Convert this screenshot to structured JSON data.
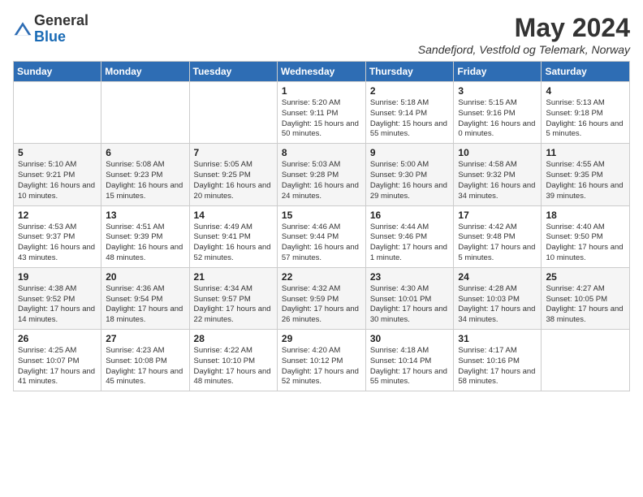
{
  "logo": {
    "general": "General",
    "blue": "Blue"
  },
  "header": {
    "month_year": "May 2024",
    "location": "Sandefjord, Vestfold og Telemark, Norway"
  },
  "days_of_week": [
    "Sunday",
    "Monday",
    "Tuesday",
    "Wednesday",
    "Thursday",
    "Friday",
    "Saturday"
  ],
  "weeks": [
    [
      {
        "day": "",
        "info": ""
      },
      {
        "day": "",
        "info": ""
      },
      {
        "day": "",
        "info": ""
      },
      {
        "day": "1",
        "info": "Sunrise: 5:20 AM\nSunset: 9:11 PM\nDaylight: 15 hours and 50 minutes."
      },
      {
        "day": "2",
        "info": "Sunrise: 5:18 AM\nSunset: 9:14 PM\nDaylight: 15 hours and 55 minutes."
      },
      {
        "day": "3",
        "info": "Sunrise: 5:15 AM\nSunset: 9:16 PM\nDaylight: 16 hours and 0 minutes."
      },
      {
        "day": "4",
        "info": "Sunrise: 5:13 AM\nSunset: 9:18 PM\nDaylight: 16 hours and 5 minutes."
      }
    ],
    [
      {
        "day": "5",
        "info": "Sunrise: 5:10 AM\nSunset: 9:21 PM\nDaylight: 16 hours and 10 minutes."
      },
      {
        "day": "6",
        "info": "Sunrise: 5:08 AM\nSunset: 9:23 PM\nDaylight: 16 hours and 15 minutes."
      },
      {
        "day": "7",
        "info": "Sunrise: 5:05 AM\nSunset: 9:25 PM\nDaylight: 16 hours and 20 minutes."
      },
      {
        "day": "8",
        "info": "Sunrise: 5:03 AM\nSunset: 9:28 PM\nDaylight: 16 hours and 24 minutes."
      },
      {
        "day": "9",
        "info": "Sunrise: 5:00 AM\nSunset: 9:30 PM\nDaylight: 16 hours and 29 minutes."
      },
      {
        "day": "10",
        "info": "Sunrise: 4:58 AM\nSunset: 9:32 PM\nDaylight: 16 hours and 34 minutes."
      },
      {
        "day": "11",
        "info": "Sunrise: 4:55 AM\nSunset: 9:35 PM\nDaylight: 16 hours and 39 minutes."
      }
    ],
    [
      {
        "day": "12",
        "info": "Sunrise: 4:53 AM\nSunset: 9:37 PM\nDaylight: 16 hours and 43 minutes."
      },
      {
        "day": "13",
        "info": "Sunrise: 4:51 AM\nSunset: 9:39 PM\nDaylight: 16 hours and 48 minutes."
      },
      {
        "day": "14",
        "info": "Sunrise: 4:49 AM\nSunset: 9:41 PM\nDaylight: 16 hours and 52 minutes."
      },
      {
        "day": "15",
        "info": "Sunrise: 4:46 AM\nSunset: 9:44 PM\nDaylight: 16 hours and 57 minutes."
      },
      {
        "day": "16",
        "info": "Sunrise: 4:44 AM\nSunset: 9:46 PM\nDaylight: 17 hours and 1 minute."
      },
      {
        "day": "17",
        "info": "Sunrise: 4:42 AM\nSunset: 9:48 PM\nDaylight: 17 hours and 5 minutes."
      },
      {
        "day": "18",
        "info": "Sunrise: 4:40 AM\nSunset: 9:50 PM\nDaylight: 17 hours and 10 minutes."
      }
    ],
    [
      {
        "day": "19",
        "info": "Sunrise: 4:38 AM\nSunset: 9:52 PM\nDaylight: 17 hours and 14 minutes."
      },
      {
        "day": "20",
        "info": "Sunrise: 4:36 AM\nSunset: 9:54 PM\nDaylight: 17 hours and 18 minutes."
      },
      {
        "day": "21",
        "info": "Sunrise: 4:34 AM\nSunset: 9:57 PM\nDaylight: 17 hours and 22 minutes."
      },
      {
        "day": "22",
        "info": "Sunrise: 4:32 AM\nSunset: 9:59 PM\nDaylight: 17 hours and 26 minutes."
      },
      {
        "day": "23",
        "info": "Sunrise: 4:30 AM\nSunset: 10:01 PM\nDaylight: 17 hours and 30 minutes."
      },
      {
        "day": "24",
        "info": "Sunrise: 4:28 AM\nSunset: 10:03 PM\nDaylight: 17 hours and 34 minutes."
      },
      {
        "day": "25",
        "info": "Sunrise: 4:27 AM\nSunset: 10:05 PM\nDaylight: 17 hours and 38 minutes."
      }
    ],
    [
      {
        "day": "26",
        "info": "Sunrise: 4:25 AM\nSunset: 10:07 PM\nDaylight: 17 hours and 41 minutes."
      },
      {
        "day": "27",
        "info": "Sunrise: 4:23 AM\nSunset: 10:08 PM\nDaylight: 17 hours and 45 minutes."
      },
      {
        "day": "28",
        "info": "Sunrise: 4:22 AM\nSunset: 10:10 PM\nDaylight: 17 hours and 48 minutes."
      },
      {
        "day": "29",
        "info": "Sunrise: 4:20 AM\nSunset: 10:12 PM\nDaylight: 17 hours and 52 minutes."
      },
      {
        "day": "30",
        "info": "Sunrise: 4:18 AM\nSunset: 10:14 PM\nDaylight: 17 hours and 55 minutes."
      },
      {
        "day": "31",
        "info": "Sunrise: 4:17 AM\nSunset: 10:16 PM\nDaylight: 17 hours and 58 minutes."
      },
      {
        "day": "",
        "info": ""
      }
    ]
  ]
}
